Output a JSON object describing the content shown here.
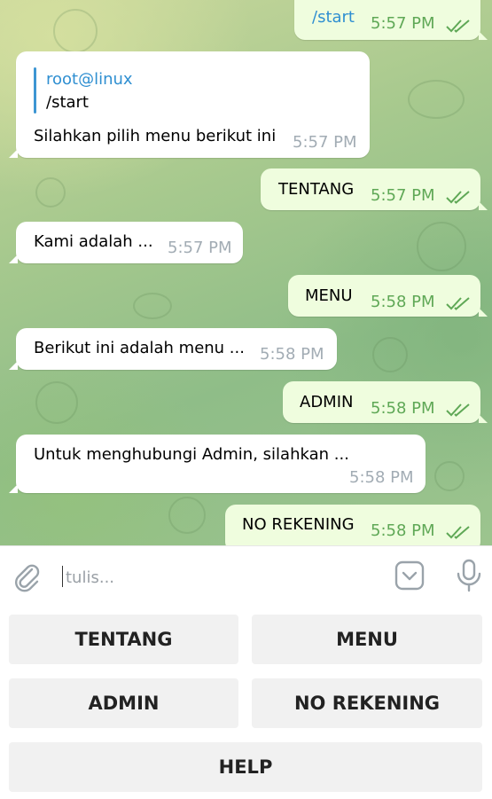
{
  "messages": [
    {
      "text": "/start",
      "time": "5:57 PM",
      "direction": "outgoing"
    },
    {
      "reply_to_name": "root@linux",
      "reply_to_text": "/start",
      "text": "Silahkan pilih menu berikut ini",
      "time": "5:57 PM",
      "direction": "incoming"
    },
    {
      "text": "TENTANG",
      "time": "5:57 PM",
      "direction": "outgoing"
    },
    {
      "text": "Kami adalah ...",
      "time": "5:57 PM",
      "direction": "incoming"
    },
    {
      "text": "MENU",
      "time": "5:58 PM",
      "direction": "outgoing"
    },
    {
      "text": "Berikut ini adalah menu ...",
      "time": "5:58 PM",
      "direction": "incoming"
    },
    {
      "text": "ADMIN",
      "time": "5:58 PM",
      "direction": "outgoing"
    },
    {
      "text": "Untuk menghubungi Admin, silahkan ...",
      "time": "5:58 PM",
      "direction": "incoming"
    },
    {
      "text": "NO REKENING",
      "time": "5:58 PM",
      "direction": "outgoing"
    }
  ],
  "input": {
    "placeholder": "tulis...",
    "value": ""
  },
  "keyboard": {
    "buttons": [
      "TENTANG",
      "MENU",
      "ADMIN",
      "NO REKENING",
      "HELP"
    ]
  },
  "icons": {
    "attach": "paperclip-icon",
    "keyboard_toggle": "keyboard-toggle-icon",
    "microphone": "microphone-icon",
    "read_receipt": "double-check-icon"
  },
  "colors": {
    "outgoing_bubble": "#effdde",
    "incoming_bubble": "#ffffff",
    "outgoing_time": "#5fa856",
    "incoming_time": "#a2acb4",
    "link": "#2f8fd1",
    "keyboard_button": "#f1f1f1"
  }
}
